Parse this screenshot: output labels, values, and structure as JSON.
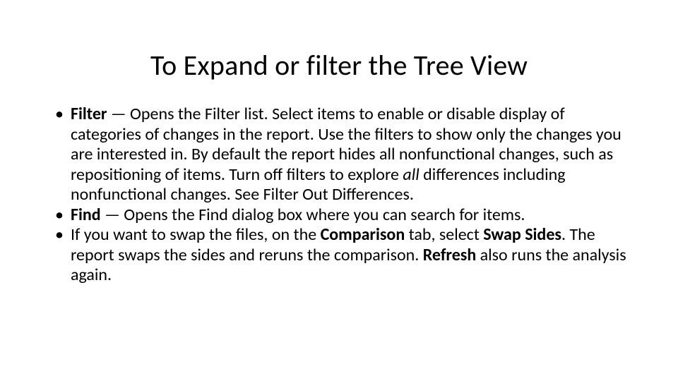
{
  "title": "To Expand or filter the Tree View",
  "bullets": [
    {
      "b1": "Filter",
      "t1": " — Opens the Filter list. Select items to enable or disable display of categories of changes in the report. Use the filters to show only the changes you are interested in. By default the report hides all nonfunctional changes, such as repositioning of items. Turn off filters to explore ",
      "i1": "all",
      "t2": " differences including nonfunctional changes. See Filter Out Differences."
    },
    {
      "b1": "Find",
      "t1": " — Opens the Find dialog box where you can search for items."
    },
    {
      "t0": "If you want to swap the files, on the ",
      "b1": "Comparison",
      "t1": " tab, select ",
      "b2": "Swap Sides",
      "t2": ". The report swaps the sides and reruns the comparison. ",
      "b3": "Refresh",
      "t3": " also runs the analysis again."
    }
  ]
}
